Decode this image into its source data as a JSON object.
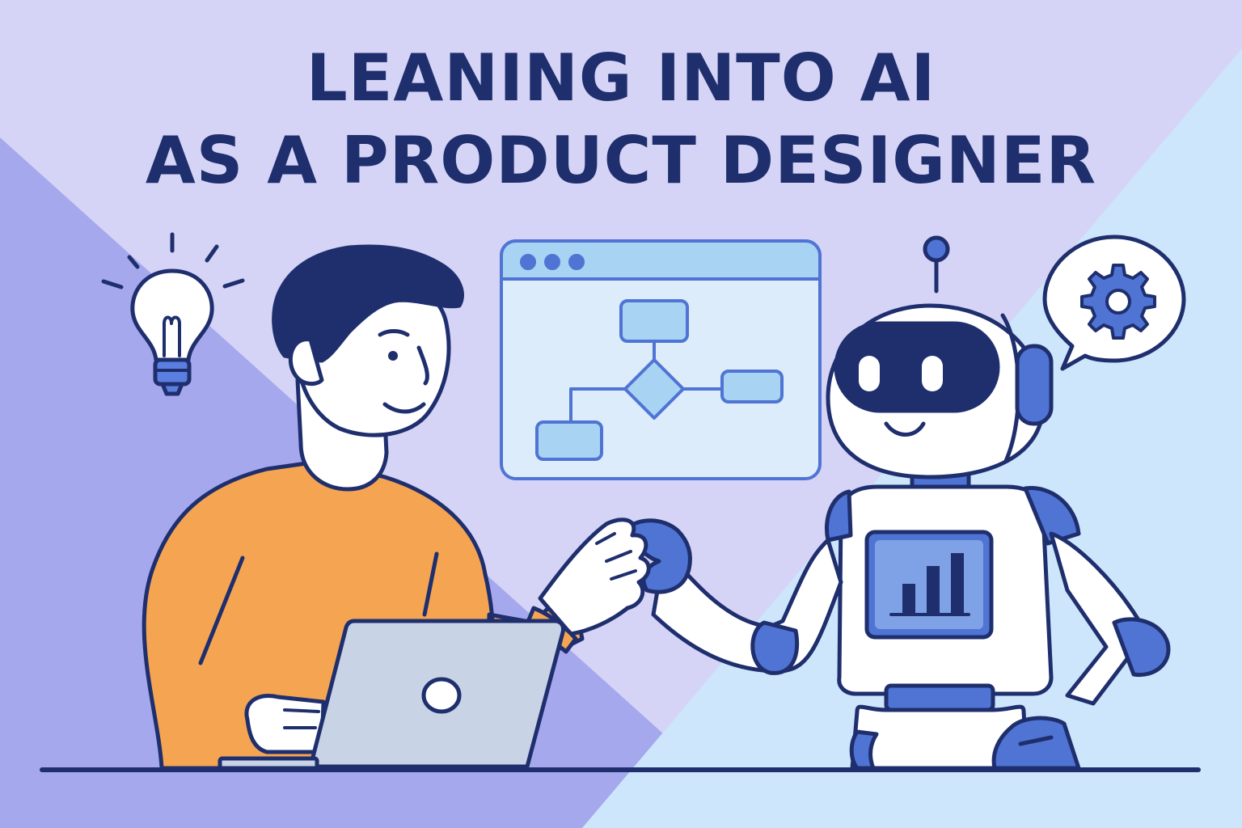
{
  "headline": {
    "line1": "LEANING INTO AI",
    "line2": "AS A PRODUCT DESIGNER"
  },
  "icons": {
    "idea": "lightbulb-icon",
    "settings": "gear-icon",
    "laptop": "laptop-icon",
    "robot": "robot-icon",
    "window": "browser-window-icon",
    "chart": "bar-chart-icon"
  },
  "colors": {
    "ink": "#1f2f6e",
    "shirt": "#f5a552",
    "robot_blue": "#4f74d3",
    "panel_blue": "#a9d3f3",
    "bg_lavender": "#d7d6f7",
    "bg_violet": "#a3a6ec",
    "bg_sky": "#cfe8fb"
  }
}
